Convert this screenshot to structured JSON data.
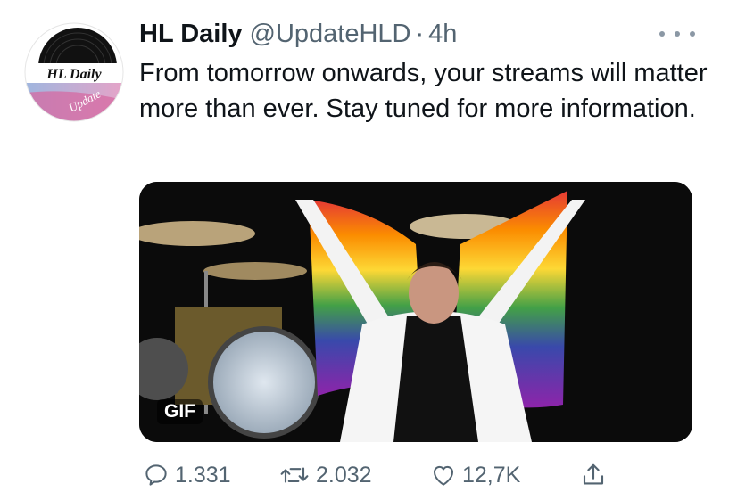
{
  "tweet": {
    "author_name": "HL Daily",
    "handle": "@UpdateHLD",
    "separator": "·",
    "time": "4h",
    "text": "From tomorrow onwards, your streams will matter more than ever. Stay tuned for more information."
  },
  "avatar": {
    "line1": "HL Daily",
    "line2": "Update"
  },
  "media": {
    "badge": "GIF"
  },
  "actions": {
    "replies": "1.331",
    "retweets": "2.032",
    "likes": "12,7K"
  },
  "icons": {
    "more": "more-horizontal-icon",
    "reply": "reply-icon",
    "retweet": "retweet-icon",
    "like": "heart-icon",
    "share": "share-icon"
  }
}
